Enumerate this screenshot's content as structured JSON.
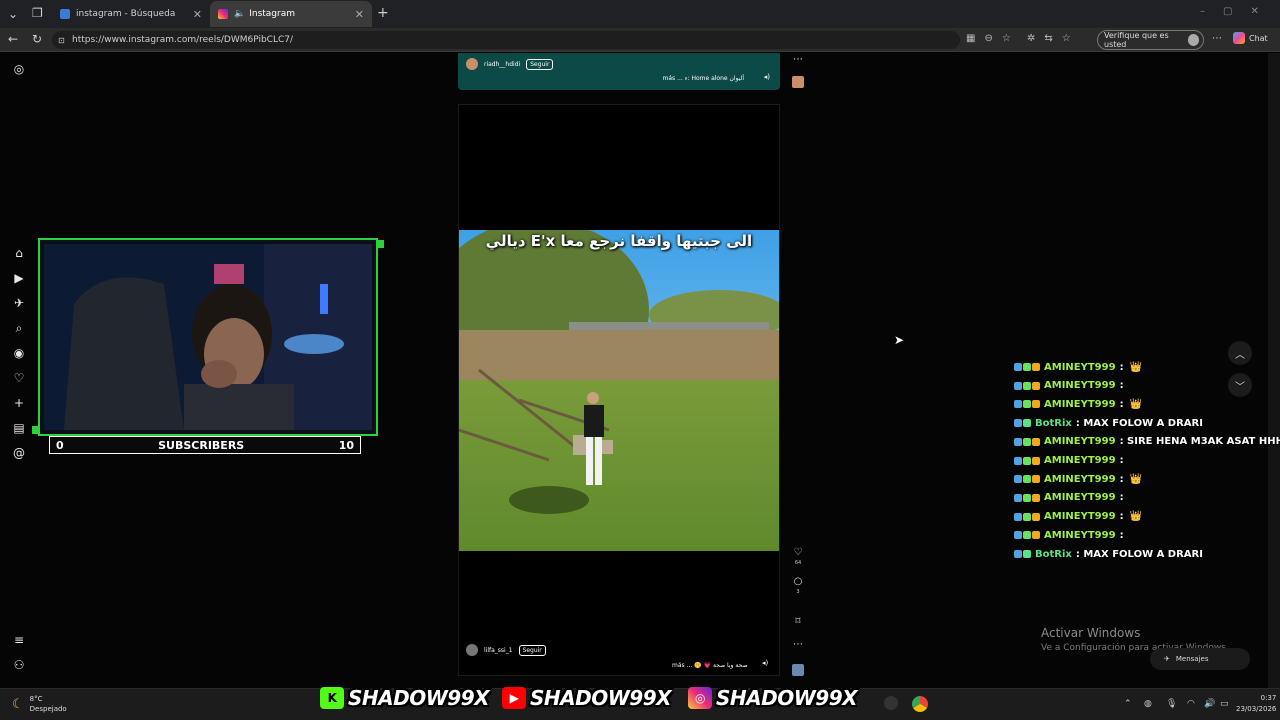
{
  "browser": {
    "tabs": [
      {
        "title": "instagram - Búsqueda"
      },
      {
        "title": "Instagram"
      }
    ],
    "url": "https://www.instagram.com/reels/DWM6PibCLC7/",
    "verify_label": "Verifique que es usted",
    "chat_label": "Chat"
  },
  "reels": {
    "top": {
      "username": "riadh__hdidi",
      "follow": "Seguir",
      "caption": "más ... ء: Home alone أليوان"
    },
    "main": {
      "overlay_text": "الى جبتيها واقفا نرجع معا E'x ديالي",
      "username": "lilfa_ssi_1",
      "follow": "Seguir",
      "caption": "más ... 🤫 💗 صحة وبا صحة",
      "likes": "64",
      "comments": "3"
    }
  },
  "stream": {
    "subscribers_label": "SUBSCRIBERS",
    "subs_current": "0",
    "subs_goal": "10",
    "chat": [
      {
        "user": "AMINEYT999",
        "message": ":",
        "emote": "👑",
        "bot": false
      },
      {
        "user": "AMINEYT999",
        "message": ":",
        "emote": "",
        "bot": false
      },
      {
        "user": "AMINEYT999",
        "message": ":",
        "emote": "👑",
        "bot": false
      },
      {
        "user": "BotRix",
        "message": ": MAX FOLOW A DRARI",
        "emote": "",
        "bot": true
      },
      {
        "user": "AMINEYT999",
        "message": ": SIRE HENA M3AK ASAT HHHH",
        "emote": "",
        "bot": false
      },
      {
        "user": "AMINEYT999",
        "message": ":",
        "emote": "",
        "bot": false
      },
      {
        "user": "AMINEYT999",
        "message": ":",
        "emote": "👑",
        "bot": false
      },
      {
        "user": "AMINEYT999",
        "message": ":",
        "emote": "",
        "bot": false
      },
      {
        "user": "AMINEYT999",
        "message": ":",
        "emote": "👑",
        "bot": false
      },
      {
        "user": "AMINEYT999",
        "message": ":",
        "emote": "",
        "bot": false
      },
      {
        "user": "BotRix",
        "message": ": MAX FOLOW A DRARI",
        "emote": "",
        "bot": true
      }
    ],
    "banner": [
      "SHADOW99X",
      "SHADOW99X",
      "SHADOW99X"
    ]
  },
  "windows": {
    "activate_title": "Activar Windows",
    "activate_sub": "Ve a Configuración para activar Windows.",
    "messages_label": "Mensajes",
    "weather_temp": "8°C",
    "weather_desc": "Despejado",
    "time": "0:37",
    "date": "23/03/2026"
  },
  "colors": {
    "accent_green": "#2fd03d",
    "chat_user": "#9cf24a",
    "reel_top_bg": "#0c4a47"
  }
}
